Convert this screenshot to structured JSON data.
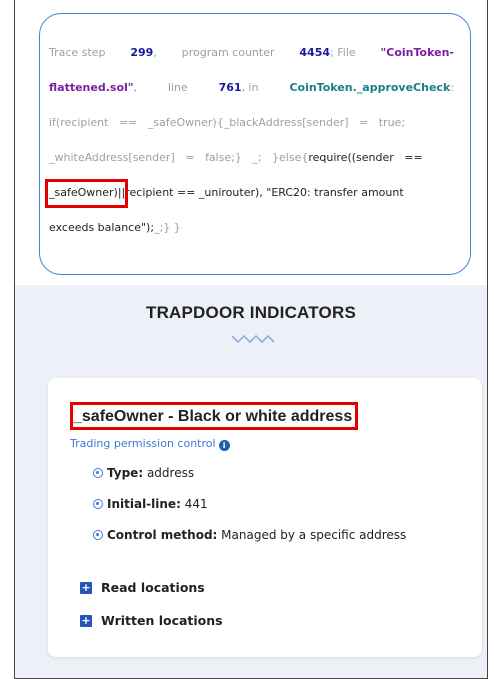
{
  "trace": {
    "prefix": "Trace step",
    "step": "299",
    "comma1": ",",
    "pc_label": "program counter",
    "pc": "4454",
    "file_label": "; File",
    "file_part1": "\"CoinToken-",
    "file_part2": "flattened.sol\"",
    "comma2": ",",
    "line_label": "line",
    "line_num": "761",
    "in_label": ", in",
    "function": "CoinToken._approveCheck",
    "colon": ":",
    "code_l3": "if(recipient == _safeOwner){_blackAddress[sender] = true;",
    "code_l4_a": "_whiteAddress[sender] = false;} _; }else{",
    "code_l4_b": "require((sender ==",
    "code_l5_hl": "_safeOwner)||",
    "code_l5_rest": "recipient == _unirouter), \"ERC20: transfer amount",
    "code_l6_a": "exceeds balance\");",
    "code_l6_b": "_;} }"
  },
  "section": {
    "title": "TRAPDOOR INDICATORS"
  },
  "indicator": {
    "title": "_safeOwner - Black or white address",
    "subtitle": "Trading permission control",
    "info_icon": "i",
    "properties": [
      {
        "label": "Type:",
        "value": "address"
      },
      {
        "label": "Initial-line:",
        "value": "441"
      },
      {
        "label": "Control method:",
        "value": "Managed by a specific address"
      }
    ],
    "expanders": [
      {
        "label": "Read locations"
      },
      {
        "label": "Written locations"
      }
    ],
    "plus_icon": "+"
  },
  "colors": {
    "card_border": "#3f82e0",
    "highlight": "#e00000",
    "file_purple": "#7a1fa0",
    "number_navy": "#1a1a9e",
    "function_teal": "#157f8c",
    "link_blue": "#3b7ad9"
  }
}
